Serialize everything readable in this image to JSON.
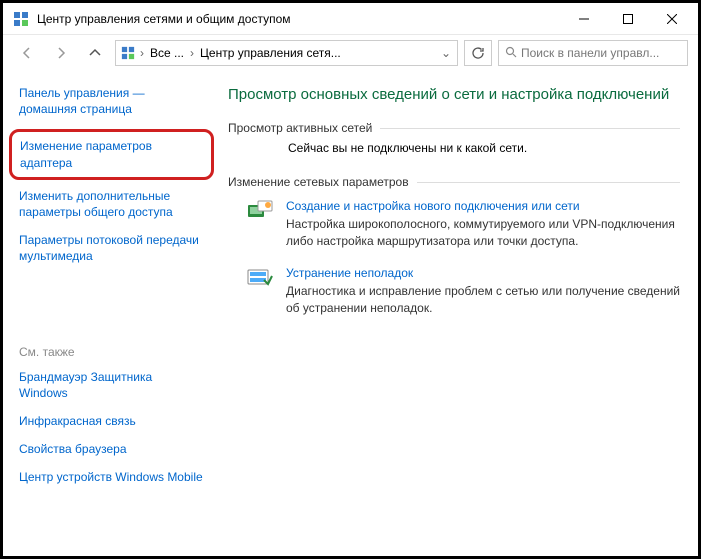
{
  "window": {
    "title": "Центр управления сетями и общим доступом"
  },
  "nav": {
    "breadcrumb": {
      "item1": "Все ...",
      "item2": "Центр управления сетя..."
    },
    "search_placeholder": "Поиск в панели управл..."
  },
  "sidebar": {
    "home": "Панель управления — домашняя страница",
    "adapter": "Изменение параметров адаптера",
    "sharing": "Изменить дополнительные параметры общего доступа",
    "streaming": "Параметры потоковой передачи мультимедиа",
    "see_also": "См. также",
    "defender": "Брандмауэр Защитника Windows",
    "infrared": "Инфракрасная связь",
    "browser": "Свойства браузера",
    "mobile": "Центр устройств Windows Mobile"
  },
  "main": {
    "heading": "Просмотр основных сведений о сети и настройка подключений",
    "active_networks_header": "Просмотр активных сетей",
    "no_network": "Сейчас вы не подключены ни к какой сети.",
    "change_settings_header": "Изменение сетевых параметров",
    "action1": {
      "link": "Создание и настройка нового подключения или сети",
      "desc": "Настройка широкополосного, коммутируемого или VPN-подключения либо настройка маршрутизатора или точки доступа."
    },
    "action2": {
      "link": "Устранение неполадок",
      "desc": "Диагностика и исправление проблем с сетью или получение сведений об устранении неполадок."
    }
  }
}
